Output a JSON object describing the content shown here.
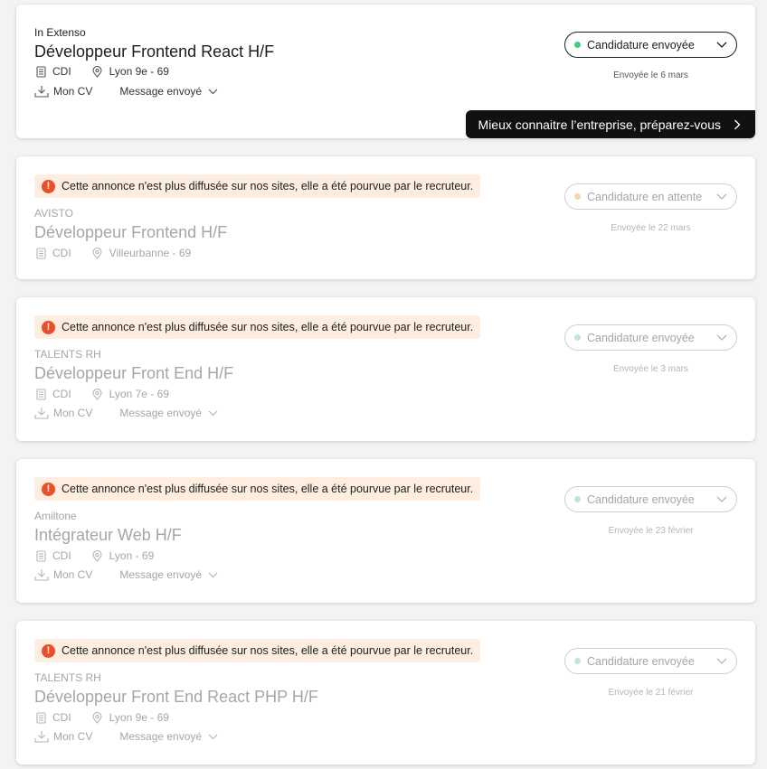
{
  "applications": [
    {
      "company": "In Extenso",
      "title": "Développeur Frontend React H/F",
      "contract": "CDI",
      "location": "Lyon 9e - 69",
      "cv_label": "Mon CV",
      "message_label": "Message envoyé",
      "status": "Candidature envoyée",
      "status_color": "#3ecf7d",
      "sent": "Envoyée le 6 mars",
      "promo": "Mieux connaitre l’entreprise, préparez-vous"
    },
    {
      "notice": "Cette annonce n'est plus diffusée sur nos sites, elle a été pourvue par le recruteur.",
      "company": "AVISTO",
      "title": "Développeur Frontend H/F",
      "contract": "CDI",
      "location": "Villeurbanne - 69",
      "status": "Candidature en attente",
      "status_color": "#f7d7aa",
      "sent": "Envoyée le 22 mars"
    },
    {
      "notice": "Cette annonce n'est plus diffusée sur nos sites, elle a été pourvue par le recruteur.",
      "company": "TALENTS RH",
      "title": "Développeur Front End H/F",
      "contract": "CDI",
      "location": "Lyon 7e - 69",
      "cv_label": "Mon CV",
      "message_label": "Message envoyé",
      "status": "Candidature envoyée",
      "status_color": "#bfe8d0",
      "sent": "Envoyée le 3 mars"
    },
    {
      "notice": "Cette annonce n'est plus diffusée sur nos sites, elle a été pourvue par le recruteur.",
      "company": "Amiltone",
      "title": "Intégrateur Web H/F",
      "contract": "CDI",
      "location": "Lyon - 69",
      "cv_label": "Mon CV",
      "message_label": "Message envoyé",
      "status": "Candidature envoyée",
      "status_color": "#bfe8d0",
      "sent": "Envoyée le 23 février"
    },
    {
      "notice": "Cette annonce n'est plus diffusée sur nos sites, elle a été pourvue par le recruteur.",
      "company": "TALENTS RH",
      "title": "Développeur Front End React PHP H/F",
      "contract": "CDI",
      "location": "Lyon 9e - 69",
      "cv_label": "Mon CV",
      "message_label": "Message envoyé",
      "status": "Candidature envoyée",
      "status_color": "#bfe8d0",
      "sent": "Envoyée le 21 février"
    }
  ],
  "icons": {
    "warning": "exclamation-icon",
    "contract": "document-icon",
    "location": "pin-icon",
    "download": "download-icon",
    "chevron": "chevron-down-icon",
    "arrow": "chevron-right-icon"
  }
}
